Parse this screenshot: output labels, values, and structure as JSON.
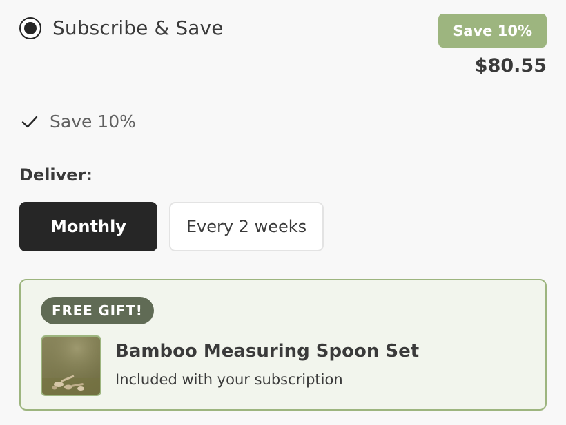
{
  "option": {
    "title": "Subscribe & Save",
    "selected": true,
    "badge": "Save 10%",
    "price": "$80.55",
    "badge_color": "#9db57f"
  },
  "benefits": [
    {
      "icon": "check-icon",
      "text": "Save 10%"
    }
  ],
  "deliver": {
    "label": "Deliver:",
    "options": [
      {
        "label": "Monthly",
        "selected": true
      },
      {
        "label": "Every 2 weeks",
        "selected": false
      }
    ]
  },
  "gift": {
    "badge": "FREE GIFT!",
    "name": "Bamboo Measuring Spoon Set",
    "subtitle": "Included with your subscription",
    "image": "bamboo-spoon-set-thumbnail",
    "border_color": "#9db57f",
    "badge_color": "#606b55"
  }
}
